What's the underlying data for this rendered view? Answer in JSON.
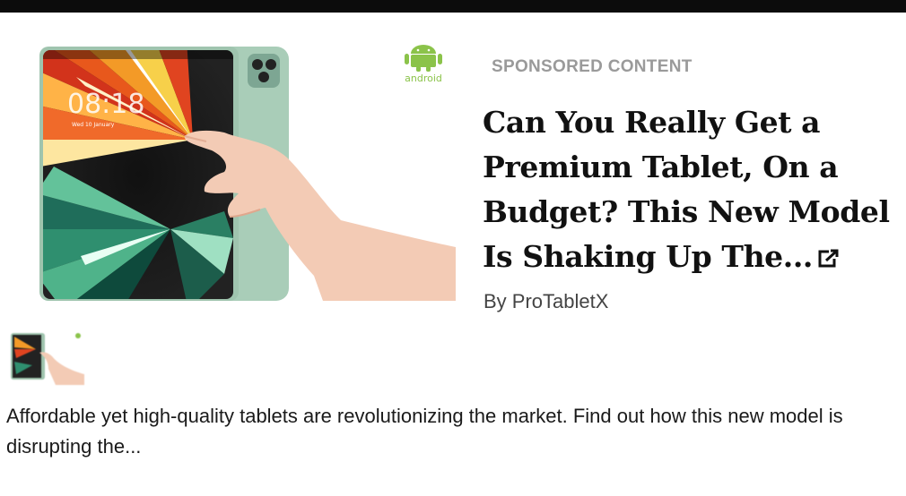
{
  "ad": {
    "sponsored_label": "SPONSORED CONTENT",
    "headline": "Can You Really Get a Premium Tablet, On a Budget? This New Model Is Shaking Up The...",
    "byline": "By ProTabletX",
    "description": "Affordable yet high-quality tablets are revolutionizing the market. Find out how this new model is disrupting the...",
    "brand_logo_text": "android",
    "tablet_screen": {
      "time": "08:18",
      "date": "Wed 10 January"
    }
  },
  "colors": {
    "android_green": "#8bc34a",
    "tablet_frame": "#a9cdb8",
    "muted_label": "#9a9a9a",
    "top_bar": "#0c0c0c"
  },
  "icons": [
    "android-logo-icon",
    "external-link-icon"
  ]
}
